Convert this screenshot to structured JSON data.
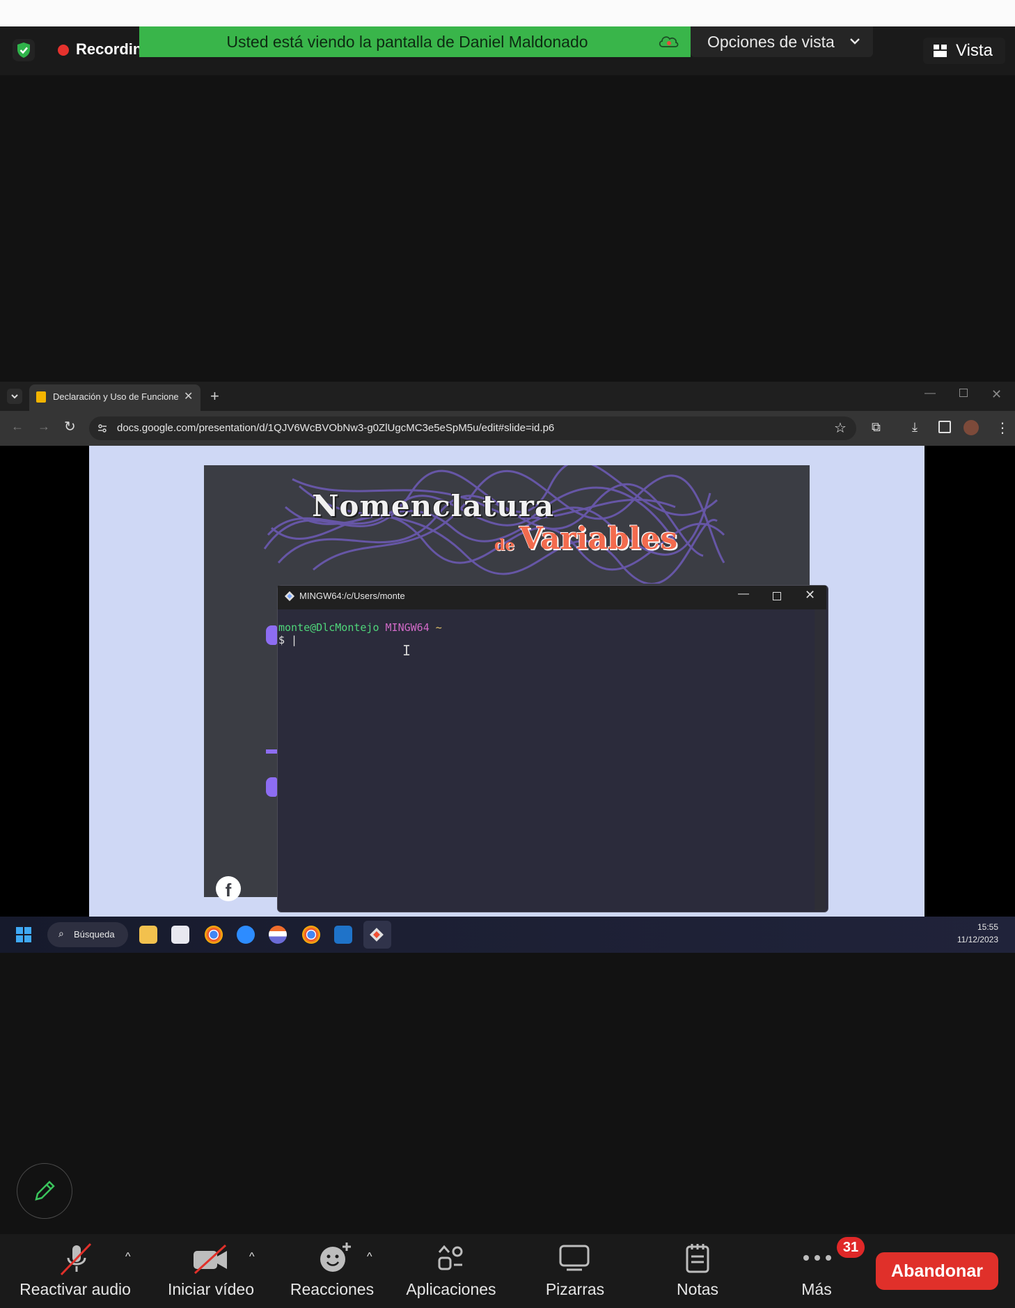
{
  "zoom_header": {
    "recording_label": "Recordin",
    "banner_text": "Usted está viendo la pantalla de Daniel Maldonado",
    "view_options_label": "Opciones de vista",
    "view_label": "Vista"
  },
  "browser": {
    "tab_title": "Declaración y Uso de Funciones",
    "url": "docs.google.com/presentation/d/1QJV6WcBVObNw3-g0ZlUgcMC3e5eSpM5u/edit#slide=id.p6"
  },
  "slide": {
    "title_line1": "Nomenclatura",
    "title_de": "de",
    "title_line2": "Variables"
  },
  "terminal": {
    "window_title": "MINGW64:/c/Users/monte",
    "prompt_user": "monte@DlcMontejo",
    "prompt_host": "MINGW64",
    "prompt_path": "~",
    "prompt_symbol": "$ |",
    "cursor_glyph": "I"
  },
  "taskbar": {
    "search_label": "Búsqueda",
    "time": "15:55",
    "date": "11/12/2023"
  },
  "toolbar": {
    "audio_label": "Reactivar audio",
    "video_label": "Iniciar vídeo",
    "reactions_label": "Reacciones",
    "apps_label": "Aplicaciones",
    "whiteboards_label": "Pizarras",
    "notes_label": "Notas",
    "more_label": "Más",
    "more_badge": "31",
    "leave_label": "Abandonar"
  },
  "colors": {
    "banner": "#39b54a",
    "recording_dot": "#e5322d",
    "leave_button": "#e0302a",
    "badge": "#e02828",
    "slide_accent": "#f36b4e",
    "terminal_user": "#4fd67a",
    "terminal_host": "#d16ac7"
  }
}
